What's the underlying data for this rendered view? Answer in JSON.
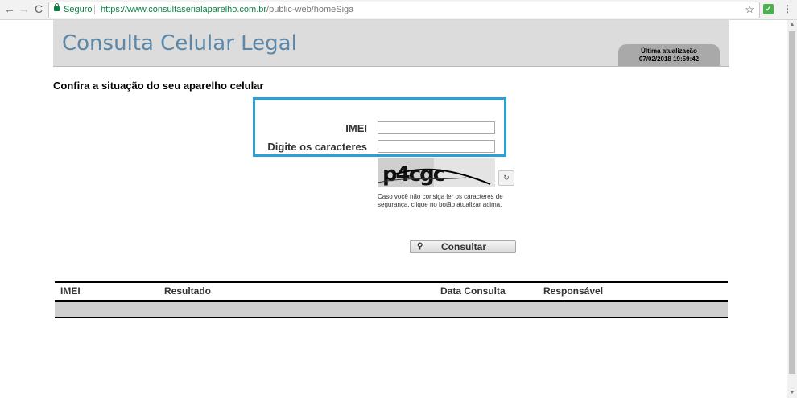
{
  "browser": {
    "secure_label": "Seguro",
    "url_host": "https://www.consultaserialaparelho.com.br",
    "url_path": "/public-web/homeSiga",
    "back_glyph": "←",
    "forward_glyph": "→",
    "reload_glyph": "C",
    "star_glyph": "☆",
    "menu_glyph": "⋮",
    "extension_glyph": "✓",
    "icons": [
      "back-icon",
      "forward-icon",
      "reload-icon",
      "lock-icon",
      "star-icon",
      "extension-icon",
      "menu-icon"
    ]
  },
  "header": {
    "title": "Consulta Celular Legal",
    "update_label": "Última atualização",
    "update_value": "07/02/2018 19:59:42"
  },
  "main": {
    "heading": "Confira a situação do seu aparelho celular",
    "imei_label": "IMEI",
    "imei_value": "",
    "captcha_label": "Digite os caracteres",
    "captcha_value": "",
    "captcha_text": "p4cgc",
    "refresh_glyph": "↻",
    "captcha_help": "Caso você não consiga ler os caracteres de segurança, clique no botão atualizar acima.",
    "submit_label": "Consultar",
    "submit_icon": "⚲"
  },
  "results": {
    "columns": [
      "IMEI",
      "Resultado",
      "Data Consulta",
      "Responsável"
    ]
  },
  "colors": {
    "title": "#5b87a8",
    "focus_border": "#2aa0d8",
    "secure": "#0b8043"
  }
}
